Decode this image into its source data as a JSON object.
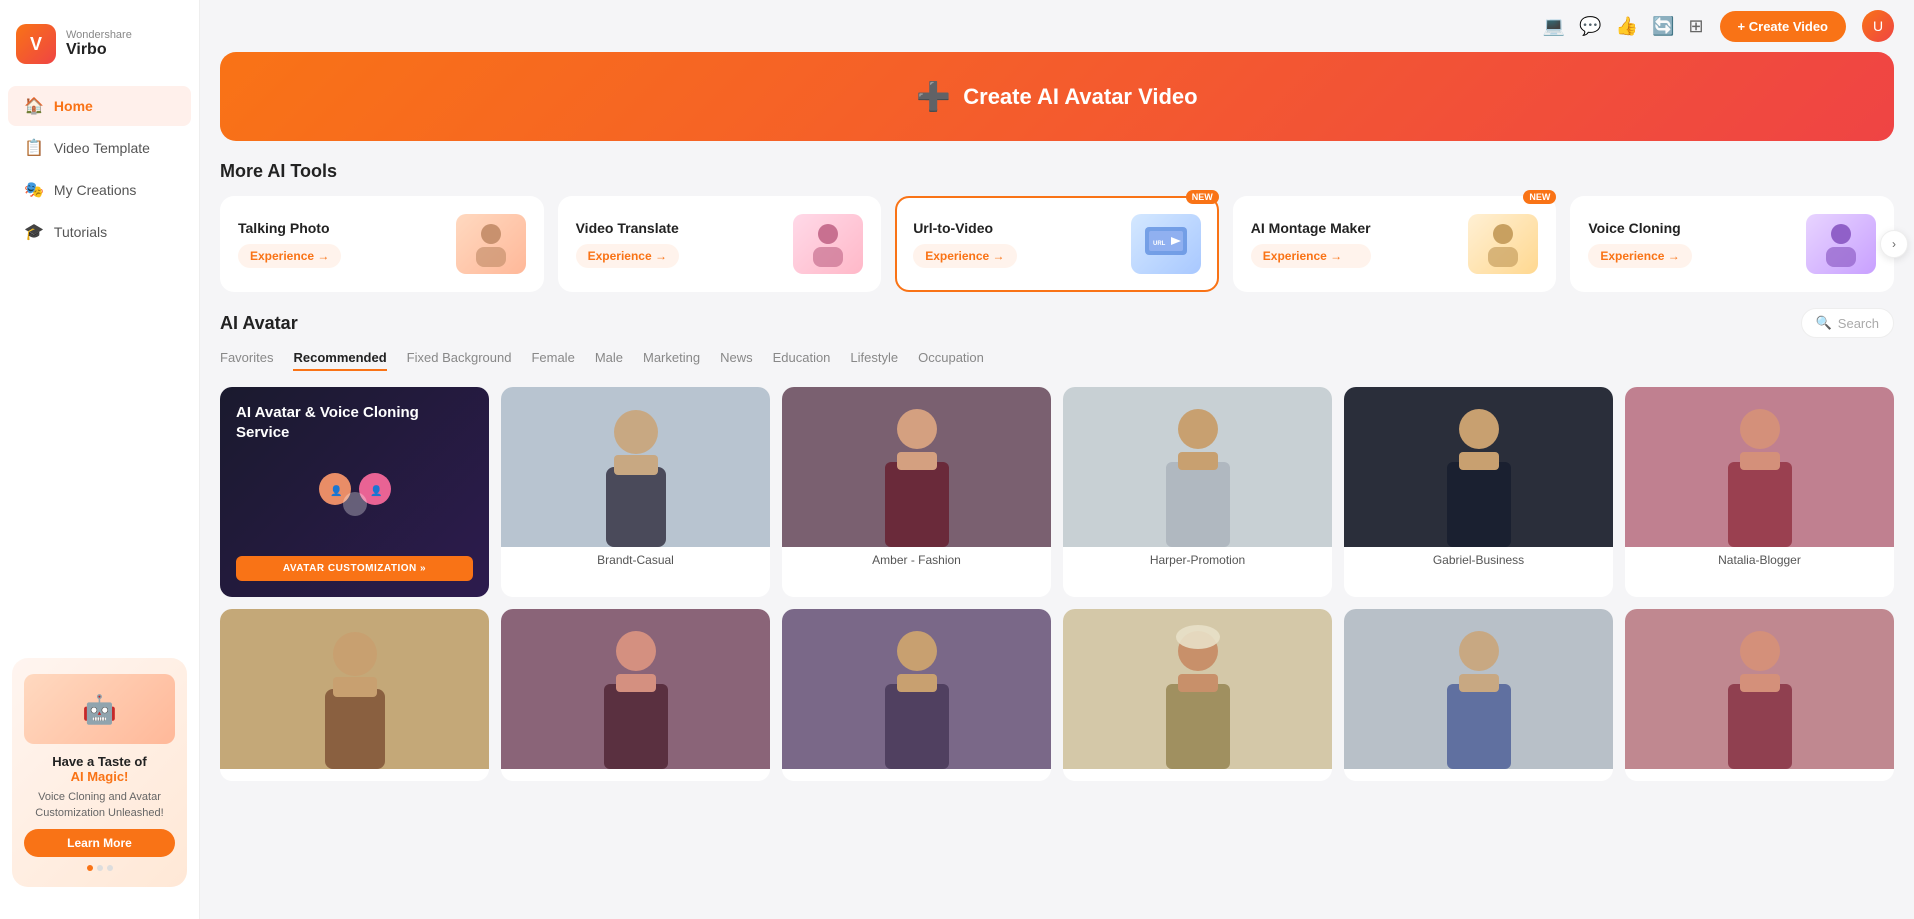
{
  "app": {
    "name": "Virbo",
    "brand": "Wondershare",
    "logo_icon": "V"
  },
  "sidebar": {
    "nav_items": [
      {
        "id": "home",
        "label": "Home",
        "icon": "🏠",
        "active": true
      },
      {
        "id": "video-template",
        "label": "Video Template",
        "icon": "📋",
        "active": false
      },
      {
        "id": "my-creations",
        "label": "My Creations",
        "icon": "🎭",
        "active": false
      },
      {
        "id": "tutorials",
        "label": "Tutorials",
        "icon": "🎓",
        "active": false
      }
    ],
    "promo": {
      "title": "Have a Taste of",
      "highlight": "AI Magic!",
      "description": "Voice Cloning and Avatar Customization Unleashed!",
      "button_label": "Learn More"
    }
  },
  "topbar": {
    "create_button": "+ Create Video",
    "icons": [
      "💻",
      "💬",
      "👍",
      "🔄",
      "⊞"
    ]
  },
  "hero": {
    "icon": "➕",
    "text": "Create AI Avatar Video"
  },
  "more_ai_tools": {
    "title": "More AI Tools",
    "tools": [
      {
        "id": "talking-photo",
        "name": "Talking Photo",
        "exp_label": "Experience →",
        "selected": false,
        "new": false,
        "icon": "📸"
      },
      {
        "id": "video-translate",
        "name": "Video Translate",
        "exp_label": "Experience →",
        "selected": false,
        "new": false,
        "icon": "🌐"
      },
      {
        "id": "url-to-video",
        "name": "Url-to-Video",
        "exp_label": "Experience →",
        "selected": true,
        "new": true,
        "icon": "🔗"
      },
      {
        "id": "ai-montage",
        "name": "AI Montage Maker",
        "exp_label": "Experience →",
        "selected": false,
        "new": true,
        "icon": "🎬"
      },
      {
        "id": "voice-cloning",
        "name": "Voice Cloning",
        "exp_label": "Experience →",
        "selected": false,
        "new": false,
        "icon": "🎙️"
      }
    ]
  },
  "ai_avatar": {
    "title": "AI Avatar",
    "search_placeholder": "Search",
    "filter_tabs": [
      {
        "id": "favorites",
        "label": "Favorites",
        "active": false
      },
      {
        "id": "recommended",
        "label": "Recommended",
        "active": true
      },
      {
        "id": "fixed-background",
        "label": "Fixed Background",
        "active": false
      },
      {
        "id": "female",
        "label": "Female",
        "active": false
      },
      {
        "id": "male",
        "label": "Male",
        "active": false
      },
      {
        "id": "marketing",
        "label": "Marketing",
        "active": false
      },
      {
        "id": "news",
        "label": "News",
        "active": false
      },
      {
        "id": "education",
        "label": "Education",
        "active": false
      },
      {
        "id": "lifestyle",
        "label": "Lifestyle",
        "active": false
      },
      {
        "id": "occupation",
        "label": "Occupation",
        "active": false
      }
    ],
    "promo_card": {
      "title": "AI Avatar & Voice Cloning Service",
      "button_label": "AVATAR CUSTOMIZATION »"
    },
    "avatars_row1": [
      {
        "id": "brandt",
        "name": "Brandt-Casual",
        "bg": "#b8c4d0",
        "skin": "#c8a882"
      },
      {
        "id": "amber",
        "name": "Amber - Fashion",
        "bg": "#6b4c5a",
        "skin": "#c8916e"
      },
      {
        "id": "harper",
        "name": "Harper-Promotion",
        "bg": "#c0c8cc",
        "skin": "#c8a882"
      },
      {
        "id": "gabriel",
        "name": "Gabriel-Business",
        "bg": "#2a2e3a",
        "skin": "#c8a882"
      },
      {
        "id": "natalia",
        "name": "Natalia-Blogger",
        "bg": "#c4888a",
        "skin": "#c8916e"
      }
    ],
    "avatars_row2": [
      {
        "id": "person6",
        "name": "",
        "bg": "#d4b896",
        "skin": "#c8a882"
      },
      {
        "id": "person7",
        "name": "",
        "bg": "#8a6478",
        "skin": "#c8916e"
      },
      {
        "id": "person8",
        "name": "",
        "bg": "#6b5a78",
        "skin": "#c8a882"
      },
      {
        "id": "person9",
        "name": "",
        "bg": "#d4c4a8",
        "skin": "#c8916e"
      },
      {
        "id": "person10",
        "name": "",
        "bg": "#b8c0c8",
        "skin": "#c8a882"
      },
      {
        "id": "person11",
        "name": "",
        "bg": "#c4888a",
        "skin": "#c8916e"
      }
    ]
  }
}
